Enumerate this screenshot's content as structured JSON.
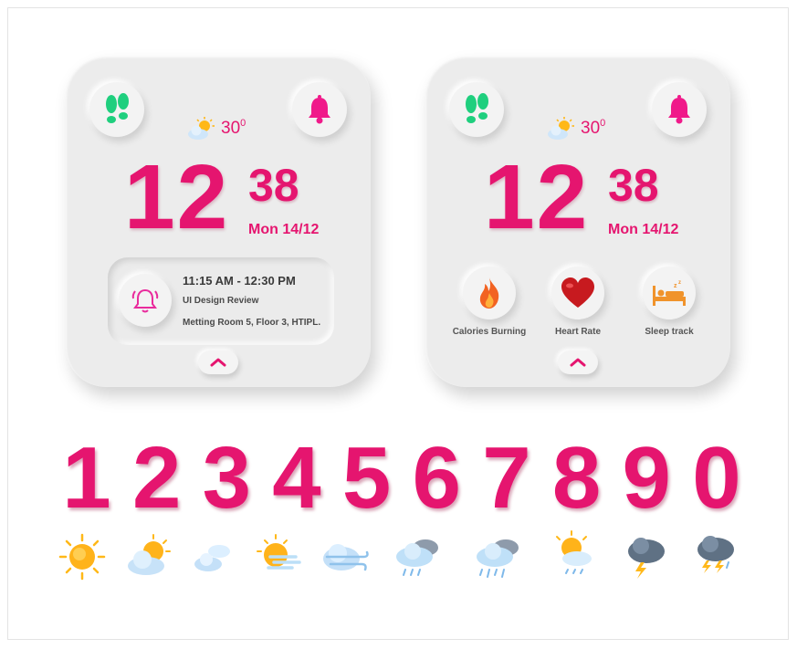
{
  "colors": {
    "accent": "#e5156f",
    "footprints": "#1fcf7e",
    "bell": "#f01a8a",
    "widget_bg": "#ececec"
  },
  "widget_left": {
    "weather": {
      "icon": "partly-sunny-icon",
      "temp": "30",
      "unit": "0"
    },
    "hour": "12",
    "minute": "38",
    "date": "Mon 14/12",
    "meeting": {
      "time": "11:15 AM - 12:30 PM",
      "title": "UI Design Review",
      "room": "Metting Room 5, Floor 3, HTIPL."
    }
  },
  "widget_right": {
    "weather": {
      "icon": "partly-sunny-icon",
      "temp": "30",
      "unit": "0"
    },
    "hour": "12",
    "minute": "38",
    "date": "Mon 14/12",
    "stats": [
      {
        "label": "Calories Burning",
        "icon": "flame-icon"
      },
      {
        "label": "Heart Rate",
        "icon": "heart-icon"
      },
      {
        "label": "Sleep track",
        "icon": "bed-icon"
      }
    ]
  },
  "digits": [
    "1",
    "2",
    "3",
    "4",
    "5",
    "6",
    "7",
    "8",
    "9",
    "0"
  ],
  "weather_icons": [
    "sun-icon",
    "partly-sunny-icon",
    "cloud-icon",
    "sun-wind-icon",
    "wind-cloud-icon",
    "rain-cloud-icon",
    "heavy-rain-cloud-icon",
    "sun-rain-icon",
    "thunder-cloud-icon",
    "thunderstorm-icon"
  ]
}
